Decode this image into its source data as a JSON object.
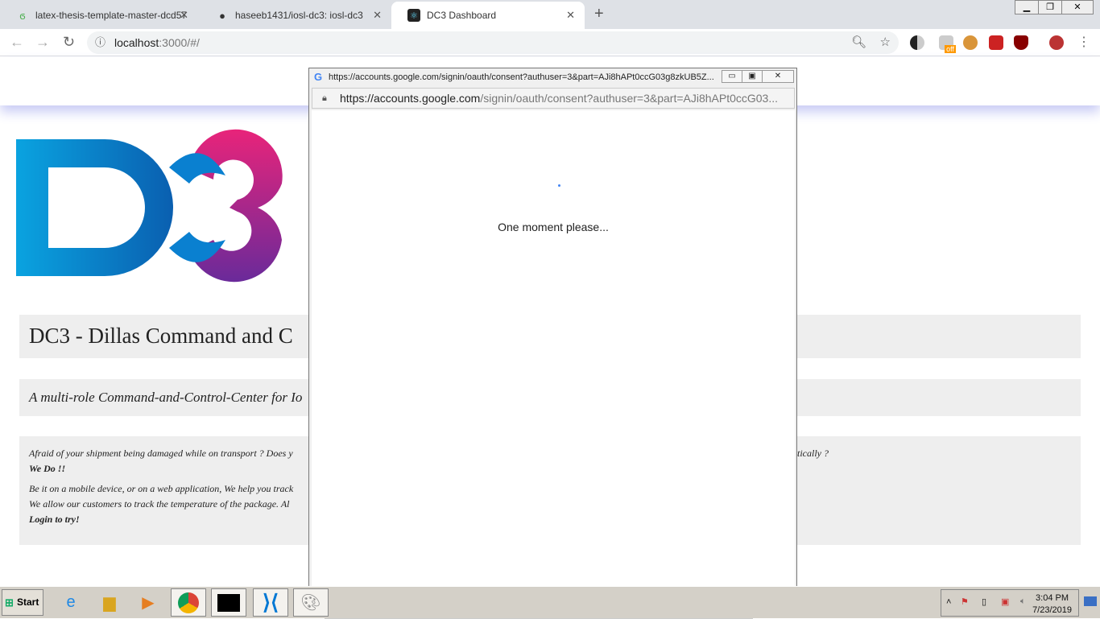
{
  "browser": {
    "tabs": [
      {
        "label": "latex-thesis-template-master-dcd57",
        "icon": "overleaf-icon"
      },
      {
        "label": "haseeb1431/iosl-dc3: iosl-dc3",
        "icon": "github-icon"
      },
      {
        "label": "DC3 Dashboard",
        "icon": "react-icon",
        "active": true
      }
    ],
    "url_host": "localhost",
    "url_rest": ":3000/#/",
    "extension_badge": "off"
  },
  "page": {
    "title": "DC3 - Dillas Command and C",
    "subtitle": "A multi-role Command-and-Control-Center for Io",
    "para1": "Afraid of your shipment being damaged while on transport ? Does y",
    "para1_end": "tically ?",
    "we_do": "We Do !!",
    "para2_line1": "Be it on a mobile device, or on a web application, We help you track",
    "para2_line2": "We allow our customers to track the temperature of the package. Al",
    "login": "Login to try!"
  },
  "popup": {
    "title": "https://accounts.google.com/signin/oauth/consent?authuser=3&part=AJi8hAPt0ccG03g8zkUB5Z...",
    "addr_host": "https://accounts.google.com",
    "addr_rest": "/signin/oauth/consent?authuser=3&part=AJi8hAPt0ccG03...",
    "message": "One moment please..."
  },
  "taskbar": {
    "start": "Start",
    "time": "3:04 PM",
    "date": "7/23/2019"
  },
  "colors": {
    "logo_blue": "#0aa3e0",
    "logo_pink": "#e8247a",
    "logo_purple": "#6a2a9a",
    "panel": "#eeeeee"
  }
}
